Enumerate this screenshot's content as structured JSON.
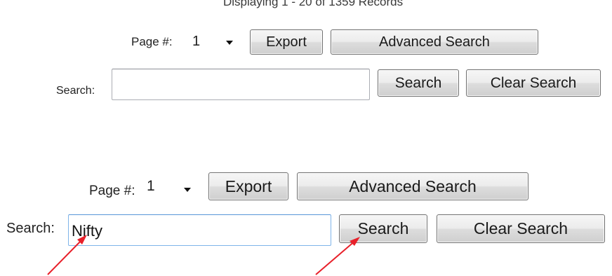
{
  "top": {
    "records_text": "Displaying 1 - 20 of 1359 Records",
    "page_label": "Page #:",
    "page_value": "1",
    "export_label": "Export",
    "advanced_label": "Advanced Search",
    "search_label": "Search:",
    "search_value": "",
    "search_button": "Search",
    "clear_button": "Clear Search"
  },
  "bottom": {
    "page_label": "Page #:",
    "page_value": "1",
    "export_label": "Export",
    "advanced_label": "Advanced Search",
    "search_label": "Search:",
    "search_value": "Nifty",
    "search_button": "Search",
    "clear_button": "Clear Search"
  },
  "annotations": {
    "arrow_color": "#e8202a"
  }
}
